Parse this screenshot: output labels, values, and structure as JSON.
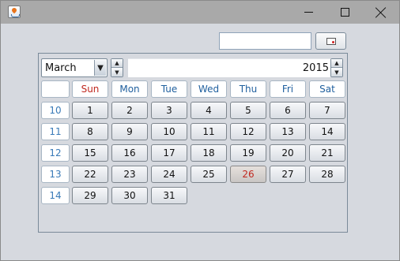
{
  "window": {
    "title": "",
    "icon": "java-cup-icon",
    "controls": [
      "minimize-icon",
      "maximize-icon",
      "close-icon"
    ]
  },
  "toolbar": {
    "date_field_value": "",
    "picker_button_icon": "calendar-icon"
  },
  "calendar": {
    "month": "March",
    "year": "2015",
    "selected_day": "26",
    "weekdays": [
      "Sun",
      "Mon",
      "Tue",
      "Wed",
      "Thu",
      "Fri",
      "Sat"
    ],
    "weeks": [
      {
        "week": "10",
        "days": [
          "1",
          "2",
          "3",
          "4",
          "5",
          "6",
          "7"
        ]
      },
      {
        "week": "11",
        "days": [
          "8",
          "9",
          "10",
          "11",
          "12",
          "13",
          "14"
        ]
      },
      {
        "week": "12",
        "days": [
          "15",
          "16",
          "17",
          "18",
          "19",
          "20",
          "21"
        ]
      },
      {
        "week": "13",
        "days": [
          "22",
          "23",
          "24",
          "25",
          "26",
          "27",
          "28"
        ]
      },
      {
        "week": "14",
        "days": [
          "29",
          "30",
          "31",
          "",
          "",
          "",
          ""
        ]
      }
    ],
    "colors": {
      "sunday_header": "#c0281f",
      "weekday_header": "#1f5f9e",
      "week_number": "#3a7bb8",
      "selected_day_text": "#c0281f"
    }
  }
}
